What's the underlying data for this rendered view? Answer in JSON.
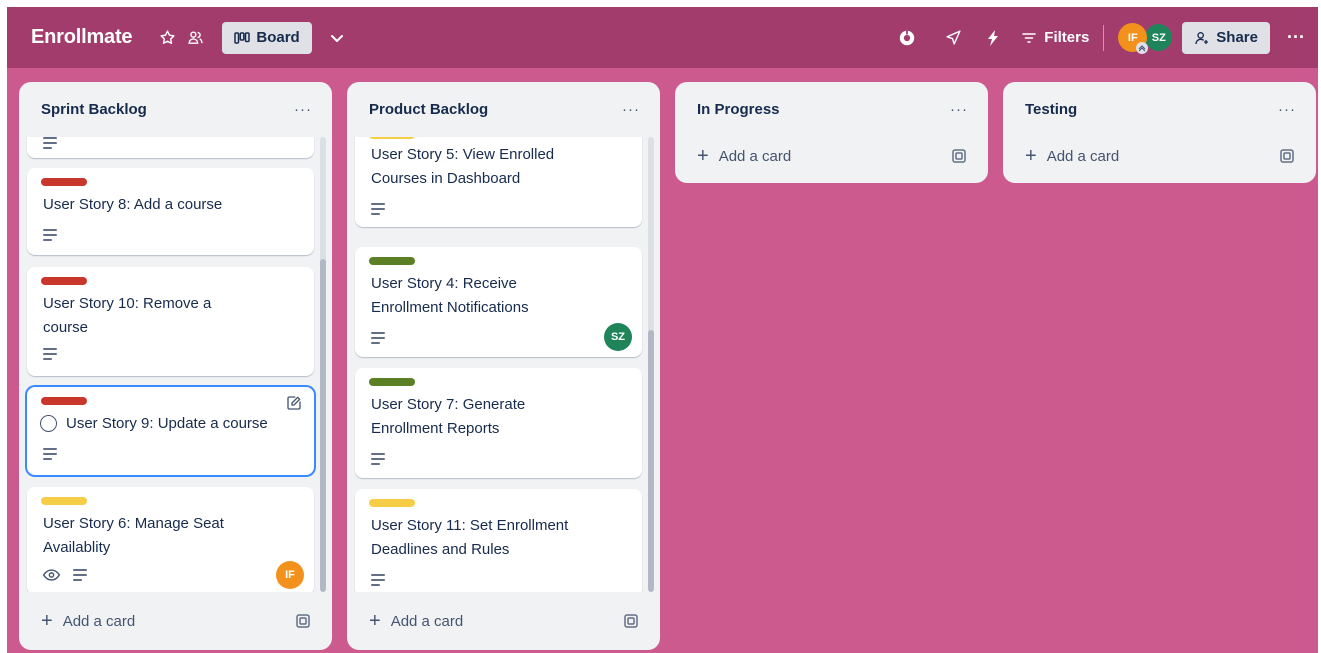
{
  "board": {
    "title": "Enrollmate",
    "view_label": "Board",
    "filters_label": "Filters",
    "share_label": "Share",
    "members": [
      {
        "initials": "IF",
        "color": "#f2921c"
      },
      {
        "initials": "SZ",
        "color": "#1f845a"
      }
    ]
  },
  "colors": {
    "header": "#a23c6c",
    "background": "#cd5a8f",
    "list": "#f1f2f4",
    "label_red": "#c9372c",
    "label_yellow": "#f5cd47",
    "label_green": "#5b7f24",
    "selected_border": "#388bff"
  },
  "lists": [
    {
      "title": "Sprint Backlog",
      "add_card": "Add a card",
      "cards": [
        {
          "title": "",
          "label_color": "",
          "has_description": true
        },
        {
          "title": "User Story 8: Add a course",
          "label_color": "#c9372c",
          "has_description": true
        },
        {
          "title": "User Story 10: Remove a course",
          "label_color": "#c9372c",
          "has_description": true
        },
        {
          "title": "User Story 9: Update a course",
          "label_color": "#c9372c",
          "has_description": true,
          "selected": true
        },
        {
          "title": "User Story 6: Manage Seat Availablity",
          "label_color": "#f5cd47",
          "has_description": true,
          "watching": true,
          "member": "IF"
        }
      ]
    },
    {
      "title": "Product Backlog",
      "add_card": "Add a card",
      "cards": [
        {
          "title": "User Story 5: View Enrolled Courses in Dashboard",
          "label_color": "#f5cd47",
          "has_description": true
        },
        {
          "title": "User Story 4: Receive Enrollment Notifications",
          "label_color": "#5b7f24",
          "has_description": true,
          "member": "SZ"
        },
        {
          "title": "User Story 7: Generate Enrollment Reports",
          "label_color": "#5b7f24",
          "has_description": true
        },
        {
          "title": "User Story 11: Set Enrollment Deadlines and Rules",
          "label_color": "#f5cd47",
          "has_description": true
        }
      ]
    },
    {
      "title": "In Progress",
      "add_card": "Add a card",
      "cards": []
    },
    {
      "title": "Testing",
      "add_card": "Add a card",
      "cards": []
    }
  ]
}
